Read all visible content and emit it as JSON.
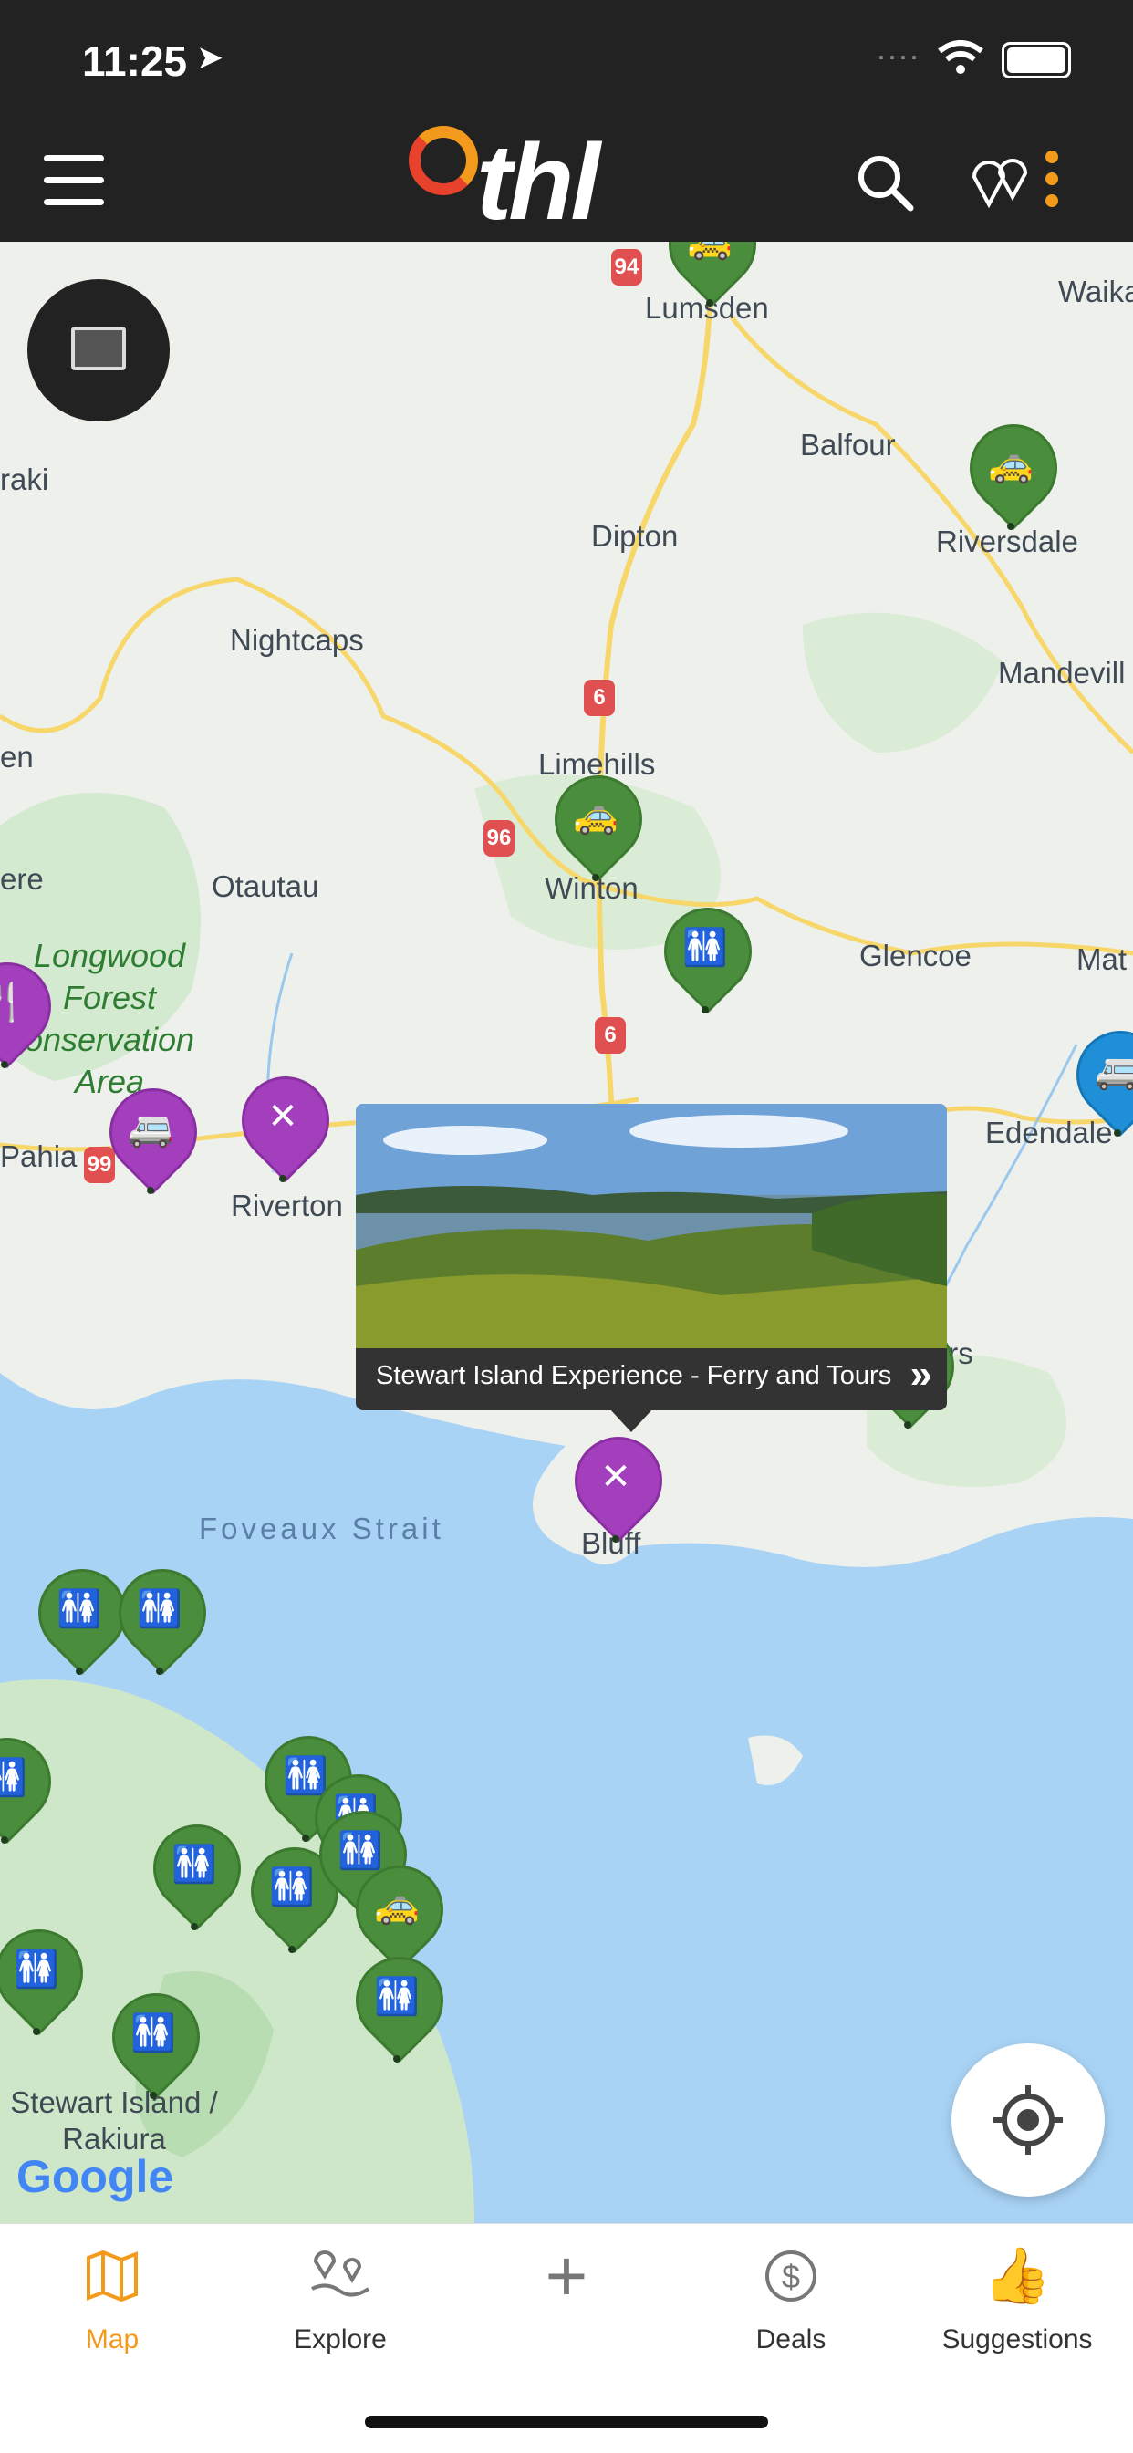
{
  "status": {
    "time": "11:25"
  },
  "header": {
    "logo_text": "thl",
    "icons": [
      "menu-icon",
      "search-icon",
      "map-pins-icon",
      "more-vertical-icon"
    ]
  },
  "map": {
    "places": [
      "Lumsden",
      "Waika",
      "Balfour",
      "Riversdale",
      "raki",
      "Dipton",
      "Mandevill",
      "Nightcaps",
      "Limehills",
      "en",
      "Winton",
      "ere",
      "Otautau",
      "Glencoe",
      "Mat",
      "Edendale",
      "Riverton",
      "Pahia",
      "Ashers",
      "Foveaux Strait",
      "Bluff",
      "Stewart Island / Rakiura"
    ],
    "area_label": [
      "Longwood",
      "Forest",
      "onservation",
      "Area"
    ],
    "roads": [
      "94",
      "6",
      "96",
      "6",
      "99",
      "99"
    ],
    "popup": {
      "title": "Stewart Island Experience - Ferry and Tours",
      "arrow": "»"
    },
    "google": "Google",
    "colors": {
      "water": "#a9d3f5",
      "land": "#eef0ec",
      "park": "#cfe7c9",
      "pin_green": "#4a8d3c",
      "pin_purple": "#a33fbd",
      "pin_blue": "#1f8fd8"
    }
  },
  "tabs": [
    {
      "label": "Map",
      "icon": "map-icon",
      "active": true
    },
    {
      "label": "Explore",
      "icon": "explore-icon",
      "active": false
    },
    {
      "label": "",
      "icon": "plus-icon",
      "active": false
    },
    {
      "label": "Deals",
      "icon": "dollar-icon",
      "active": false
    },
    {
      "label": "Suggestions",
      "icon": "thumbs-up-icon",
      "active": false
    }
  ]
}
